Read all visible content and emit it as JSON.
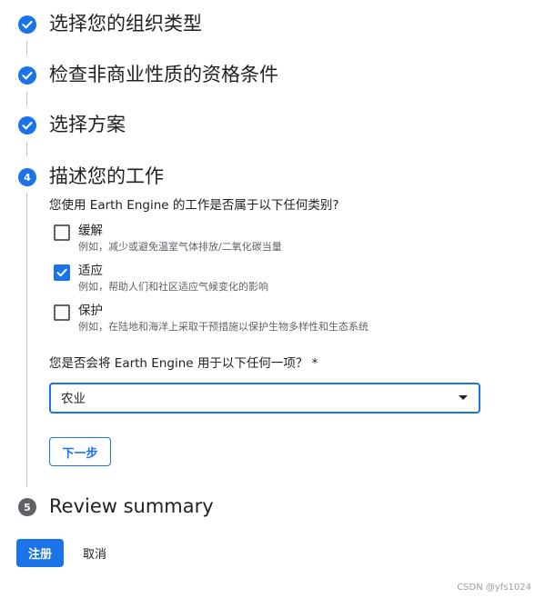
{
  "steps": [
    {
      "title": "选择您的组织类型",
      "status": "completed"
    },
    {
      "title": "检查非商业性质的资格条件",
      "status": "completed"
    },
    {
      "title": "选择方案",
      "status": "completed"
    },
    {
      "number": "4",
      "title": "描述您的工作",
      "status": "active"
    },
    {
      "number": "5",
      "title": "Review summary",
      "status": "pending"
    }
  ],
  "work": {
    "question": "您使用 Earth Engine 的工作是否属于以下任何类别?",
    "options": [
      {
        "label": "缓解",
        "description": "例如，减少或避免温室气体排放/二氧化碳当量",
        "checked": false
      },
      {
        "label": "适应",
        "description": "例如，帮助人们和社区适应气候变化的影响",
        "checked": true
      },
      {
        "label": "保护",
        "description": "例如，在陆地和海洋上采取干预措施以保护生物多样性和生态系统",
        "checked": false
      }
    ],
    "use_question": "您是否会将 Earth Engine 用于以下任何一项？ *",
    "use_value": "农业",
    "next_label": "下一步"
  },
  "footer": {
    "register_label": "注册",
    "cancel_label": "取消"
  },
  "watermark": "CSDN @yfs1024",
  "colors": {
    "accent": "#1a73e8",
    "pending_step": "#5f6368",
    "connector": "#bdc1c6"
  },
  "icons": {
    "completed_step": "check-circle-icon",
    "dropdown": "caret-down-icon",
    "checkbox_checked": "checkmark-icon"
  }
}
